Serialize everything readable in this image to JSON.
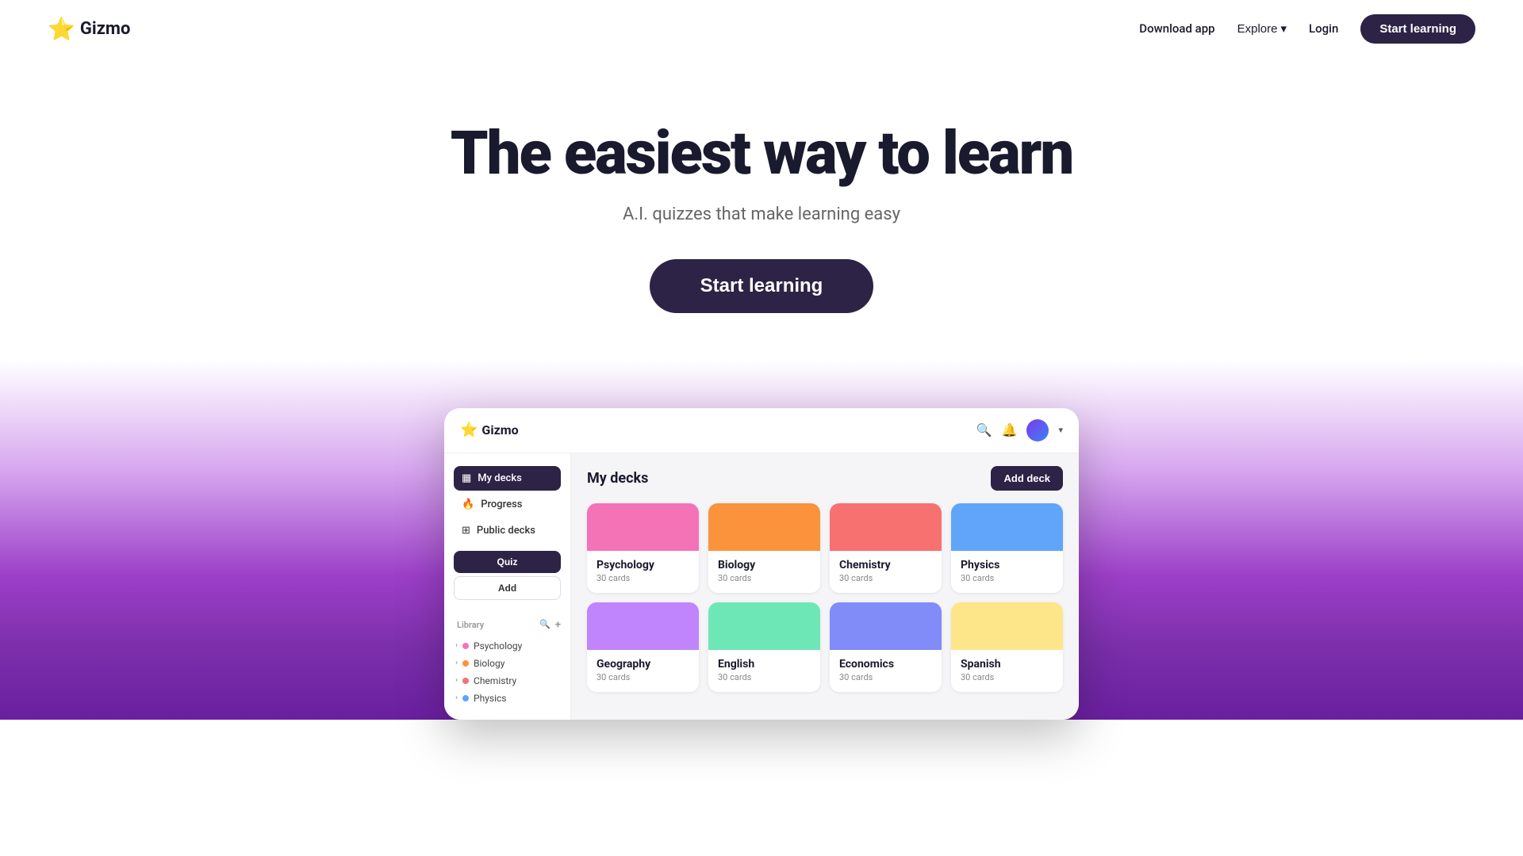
{
  "nav": {
    "logo_text": "Gizmo",
    "star_icon": "⭐",
    "links": [
      {
        "label": "Download app",
        "id": "download-app"
      },
      {
        "label": "Explore",
        "id": "explore"
      },
      {
        "label": "Login",
        "id": "login"
      }
    ],
    "cta_label": "Start learning"
  },
  "hero": {
    "heading": "The easiest way to learn",
    "subheading": "A.I. quizzes that make learning easy",
    "cta_label": "Start learning"
  },
  "app": {
    "logo_text": "Gizmo",
    "star_icon": "⭐",
    "sidebar": {
      "nav_items": [
        {
          "label": "My decks",
          "icon": "▦",
          "active": true
        },
        {
          "label": "Progress",
          "icon": "🔥"
        },
        {
          "label": "Public decks",
          "icon": "⊞"
        }
      ],
      "quiz_btn": "Quiz",
      "add_btn": "Add",
      "library_label": "Library",
      "library_items": [
        {
          "label": "Psychology",
          "color": "#f472b6"
        },
        {
          "label": "Biology",
          "color": "#fb923c"
        },
        {
          "label": "Chemistry",
          "color": "#f87171"
        },
        {
          "label": "Physics",
          "color": "#60a5fa"
        }
      ]
    },
    "main": {
      "title": "My decks",
      "add_deck_btn": "Add deck",
      "decks": [
        {
          "name": "Psychology",
          "count": "30 cards",
          "color": "#f472b6"
        },
        {
          "name": "Biology",
          "count": "30 cards",
          "color": "#fb923c"
        },
        {
          "name": "Chemistry",
          "count": "30 cards",
          "color": "#f87171"
        },
        {
          "name": "Physics",
          "count": "30 cards",
          "color": "#60a5fa"
        },
        {
          "name": "Geography",
          "count": "30 cards",
          "color": "#c084fc"
        },
        {
          "name": "English",
          "count": "30 cards",
          "color": "#6ee7b7"
        },
        {
          "name": "Economics",
          "count": "30 cards",
          "color": "#818cf8"
        },
        {
          "name": "Spanish",
          "count": "30 cards",
          "color": "#fde68a"
        }
      ]
    }
  }
}
